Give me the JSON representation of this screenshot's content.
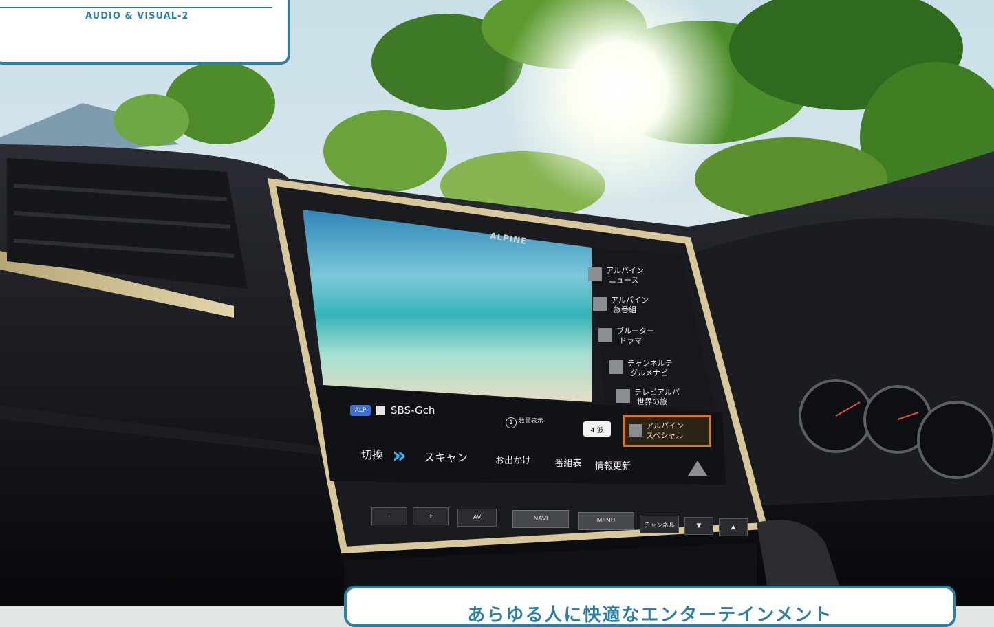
{
  "header": {
    "label": "AUDIO & VISUAL-2"
  },
  "screen": {
    "brand": "ALPINE",
    "status": {
      "network_badge": "ALP",
      "channel": "SBS-Gch",
      "index_badge": "1",
      "mini_info": "数量表示",
      "signal_badge": "4 波"
    },
    "channels": [
      {
        "line1": "アルパイン",
        "line2": "ニュース"
      },
      {
        "line1": "アルパイン",
        "line2": "旅番組"
      },
      {
        "line1": "ブルーター",
        "line2": "ドラマ"
      },
      {
        "line1": "チャンネルテ",
        "line2": "グルメナビ"
      },
      {
        "line1": "テレビアルパ",
        "line2": "世界の旅"
      },
      {
        "line1": "アルパイン",
        "line2": "スペシャル"
      }
    ],
    "tabs": [
      "切換",
      "スキャン",
      "お出かけ",
      "番組表",
      "情報更新"
    ]
  },
  "hardware_buttons": [
    "-",
    "+",
    "AV",
    "NAVI",
    "MENU",
    "チャンネル",
    "▼",
    "▲"
  ],
  "footer": {
    "caption": "あらゆる人に快適なエンターテインメント"
  },
  "colors": {
    "accent": "#2e7fa4",
    "selected": "#e0741c"
  }
}
